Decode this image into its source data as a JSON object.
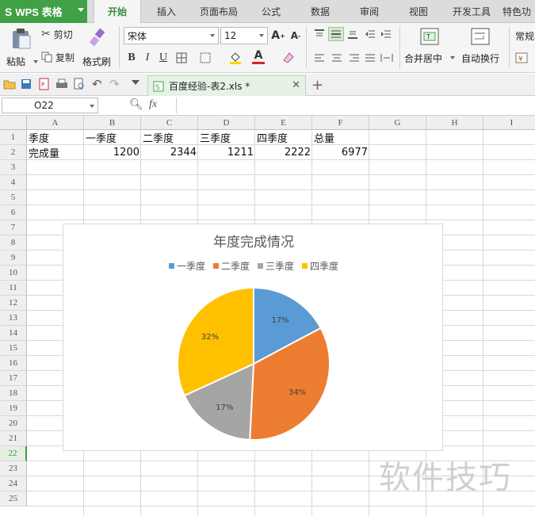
{
  "app": {
    "name": "WPS 表格"
  },
  "tabs": [
    "开始",
    "插入",
    "页面布局",
    "公式",
    "数据",
    "审阅",
    "视图",
    "开发工具",
    "特色功"
  ],
  "active_tab": "开始",
  "ribbon": {
    "paste": "粘贴",
    "cut": "剪切",
    "copy": "复制",
    "format_painter": "格式刷",
    "font_name": "宋体",
    "font_size": "12",
    "merge_center": "合并居中",
    "wrap_text": "自动换行",
    "number_format": "常规"
  },
  "document": {
    "tab_title": "百度经验-表2.xls *"
  },
  "formula_bar": {
    "cell_ref": "O22",
    "fx": "fx",
    "formula": ""
  },
  "columns": [
    "A",
    "B",
    "C",
    "D",
    "E",
    "F",
    "G",
    "H",
    "I"
  ],
  "rows": [
    "1",
    "2",
    "3",
    "4",
    "5",
    "6",
    "7",
    "8",
    "9",
    "10",
    "11",
    "12",
    "13",
    "14",
    "15",
    "16",
    "17",
    "18",
    "19",
    "20",
    "21",
    "22",
    "23",
    "24",
    "25"
  ],
  "selected_row": "22",
  "sheet": {
    "row1": [
      "季度",
      "一季度",
      "二季度",
      "三季度",
      "四季度",
      "总量"
    ],
    "row2": [
      "完成量",
      "1200",
      "2344",
      "1211",
      "2222",
      "6977"
    ]
  },
  "chart_data": {
    "type": "pie",
    "title": "年度完成情况",
    "categories": [
      "一季度",
      "二季度",
      "三季度",
      "四季度"
    ],
    "values": [
      1200,
      2344,
      1211,
      2222
    ],
    "labels": [
      "17%",
      "34%",
      "17%",
      "32%"
    ],
    "colors": [
      "#5b9bd5",
      "#ed7d31",
      "#a5a5a5",
      "#ffc000"
    ],
    "legend": "top"
  },
  "watermark": "软件技巧",
  "colors": {
    "accent": "#3fa045",
    "active_tab_text": "#3a8d3f"
  }
}
